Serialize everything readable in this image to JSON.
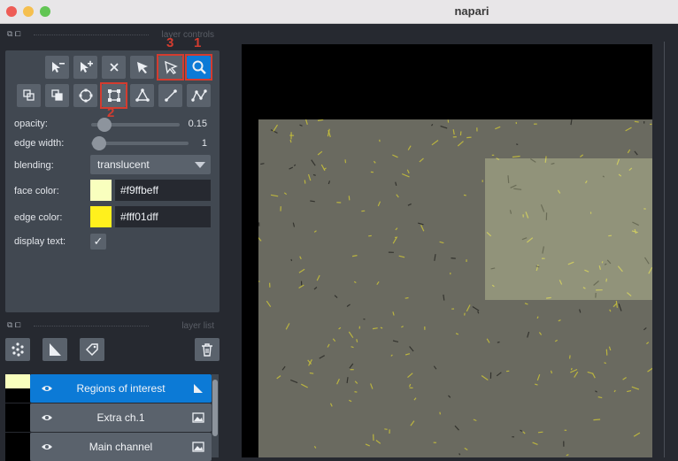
{
  "window": {
    "title": "napari"
  },
  "layer_controls": {
    "dock_title": "layer controls",
    "annotations": [
      "3",
      "1",
      "2"
    ],
    "labels": {
      "opacity": "opacity:",
      "edge_width": "edge width:",
      "blending": "blending:",
      "face_color": "face color:",
      "edge_color": "edge color:",
      "display_text": "display text:"
    },
    "opacity": {
      "value": 0.15,
      "display": "0.15"
    },
    "edge_width": {
      "value": 1,
      "display": "1"
    },
    "blending": "translucent",
    "face_color": {
      "hex": "#f9ffbeff",
      "swatch": "#f9ffbe"
    },
    "edge_color": {
      "hex": "#fff01dff",
      "swatch": "#fff01d"
    },
    "display_text_checked": true,
    "check_glyph": "✓",
    "tool_icons": [
      "delete-shape-icon",
      "add-shape-icon",
      "remove-selected-icon",
      "select-icon",
      "direct-select-icon",
      "zoom-icon",
      "move-back-icon",
      "move-front-icon",
      "ellipse-icon",
      "rectangle-icon",
      "polygon-icon",
      "line-icon",
      "path-icon"
    ]
  },
  "layer_list": {
    "dock_title": "layer list",
    "layers": [
      {
        "name": "Regions of interest",
        "type": "shapes-icon",
        "selected": true
      },
      {
        "name": "Extra ch.1",
        "type": "image-icon",
        "selected": false
      },
      {
        "name": "Main channel",
        "type": "image-icon",
        "selected": false
      }
    ]
  },
  "colors": {
    "accent": "#0c7ad6",
    "annotation_red": "#d43c2f",
    "panel_bg": "#414851",
    "app_bg": "#262930"
  }
}
